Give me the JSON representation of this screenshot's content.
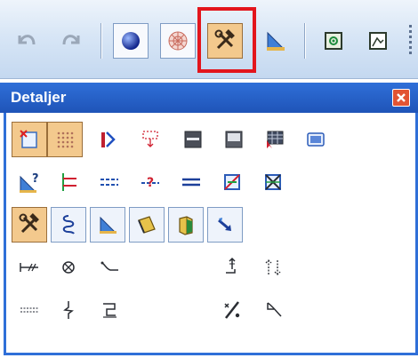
{
  "toolbar": {
    "buttons": [
      {
        "id": "undo",
        "icon": "undo-arrow-icon"
      },
      {
        "id": "redo",
        "icon": "redo-arrow-icon"
      },
      {
        "id": "sphere",
        "icon": "blue-sphere-icon"
      },
      {
        "id": "mesh",
        "icon": "mesh-ball-icon"
      },
      {
        "id": "details",
        "icon": "hammer-wrench-icon",
        "highlighted": true
      },
      {
        "id": "drafting",
        "icon": "triangle-ruler-icon"
      },
      {
        "id": "view",
        "icon": "target-window-icon"
      },
      {
        "id": "render",
        "icon": "image-window-icon"
      }
    ],
    "highlight_color": "#e3151c"
  },
  "panel": {
    "title": "Detaljer",
    "close_icon": "close-x-icon",
    "accent": "#2f6fd8",
    "rows": [
      [
        "detail-doc-icon",
        "grid-dots-icon",
        "flag-split-icon",
        "dashed-arrow-icon",
        "bar-panel-icon",
        "bar-panel-light-icon",
        "grid-cursor-icon",
        "blue-panel-icon"
      ],
      [
        "question-triangle-icon",
        "bracket-lines-icon",
        "dashed-lines-icon",
        "question-line-icon",
        "double-line-icon",
        "frame-cross-icon",
        "box-cross-icon"
      ],
      [
        "hammer-wrench-icon",
        "spring-coil-icon",
        "triangle-ruler-icon",
        "beam-profile-icon",
        "cabinet-icon",
        "arrow-diag-icon"
      ],
      [
        "hatch-line-icon",
        "circle-cross-icon",
        "curve-hook-icon",
        "tee-arrow-icon",
        "dotted-arrows-icon"
      ],
      [
        "dash-line-icon",
        "squiggle-line-icon",
        "square-bracket-icon",
        "percent-slash-icon",
        "curve-arrow-icon"
      ]
    ]
  },
  "colors": {
    "active_bg": "#f3c98d",
    "frame": "#7f9cc4"
  }
}
